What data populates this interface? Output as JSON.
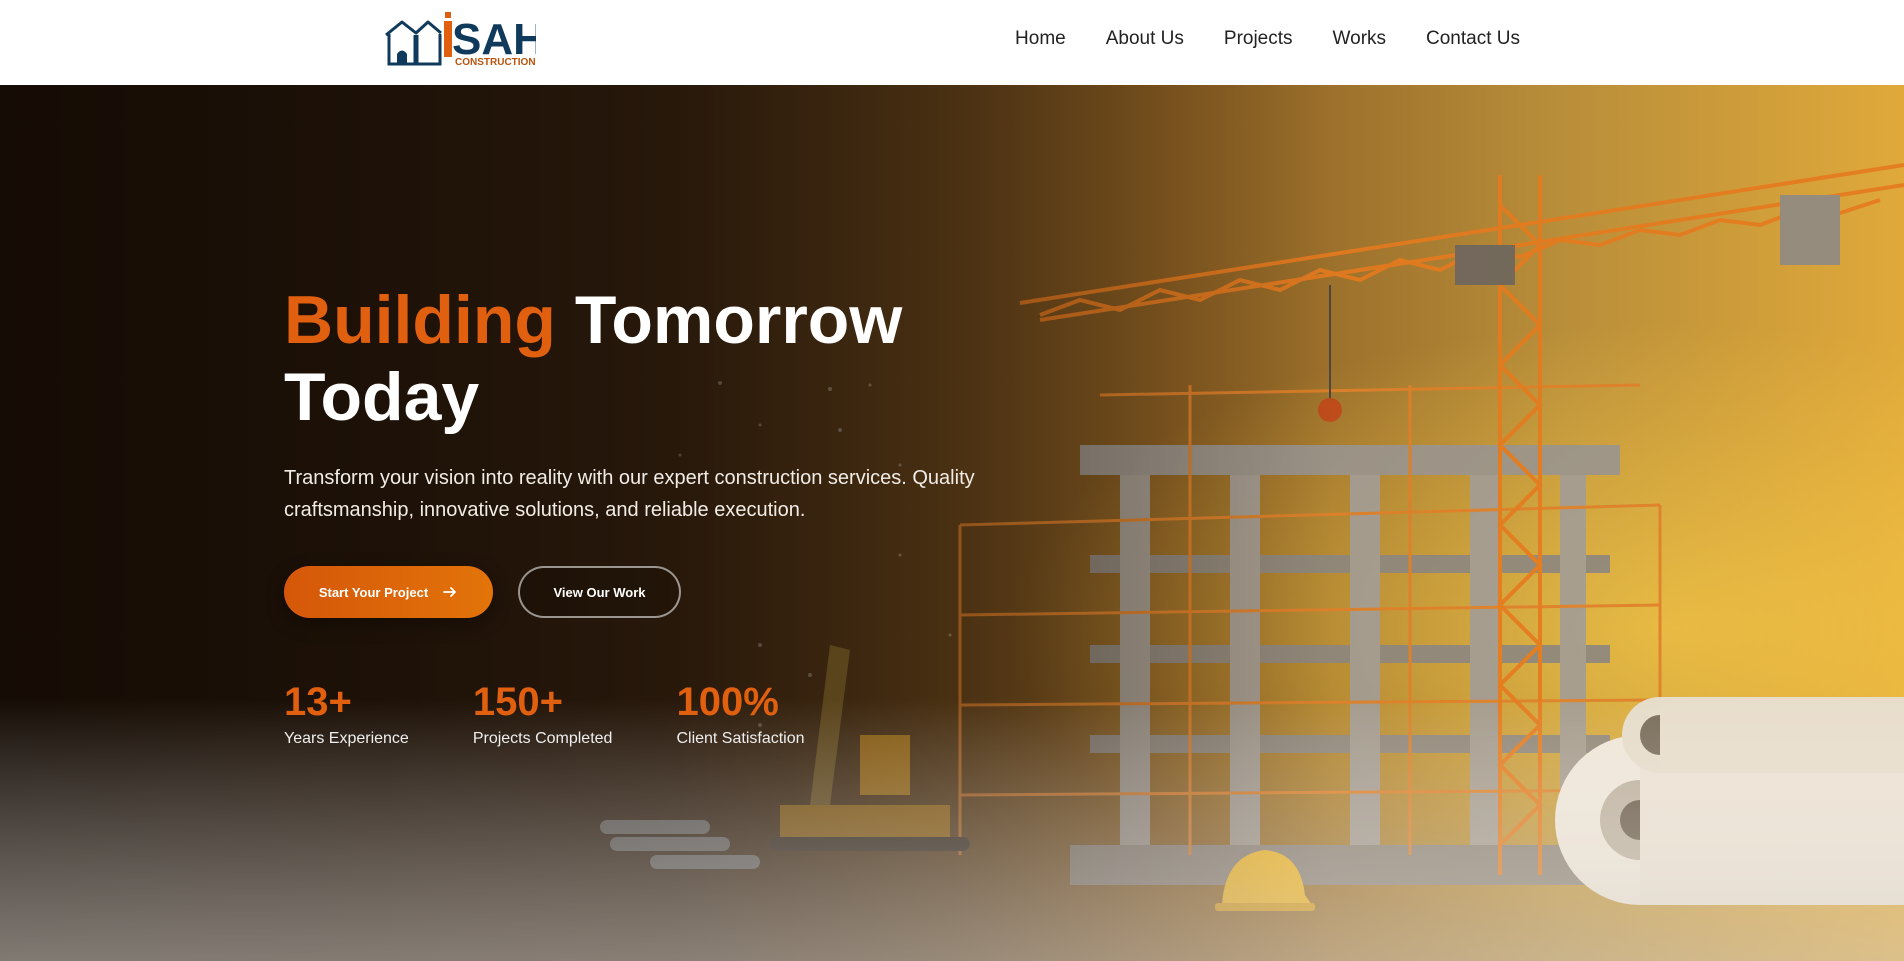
{
  "brand": {
    "logo_word": "SAH",
    "logo_letter": "i",
    "logo_sub": "CONSTRUCTIONS",
    "primary_color": "#0f3a5c",
    "accent_color": "#e06010"
  },
  "nav": {
    "items": [
      {
        "label": "Home"
      },
      {
        "label": "About Us"
      },
      {
        "label": "Projects"
      },
      {
        "label": "Works"
      },
      {
        "label": "Contact Us"
      }
    ]
  },
  "hero": {
    "headline_accent": "Building",
    "headline_rest": "Tomorrow Today",
    "subtext": "Transform your vision into reality with our expert construction services. Quality craftsmanship, innovative solutions, and reliable execution.",
    "primary_button": "Start Your Project",
    "primary_button_icon": "arrow-right-icon",
    "secondary_button": "View Our Work",
    "stats": [
      {
        "value": "13+",
        "label": "Years Experience"
      },
      {
        "value": "150+",
        "label": "Projects Completed"
      },
      {
        "value": "100%",
        "label": "Client Satisfaction"
      }
    ]
  }
}
